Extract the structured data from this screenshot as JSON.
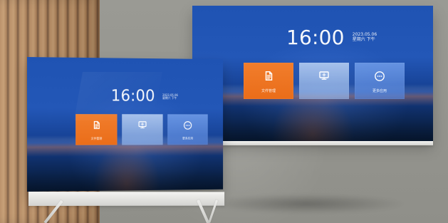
{
  "background": {
    "wall_color": "#9b9b95",
    "wood_color": "#b88b61"
  },
  "displays": {
    "large": {
      "time": "16:00",
      "date_line1": "2023.05.06",
      "date_line2": "星期六 下午",
      "tiles": [
        {
          "label": "文件管理",
          "icon": "document-icon",
          "color": "#ea6d19"
        },
        {
          "label": "",
          "icon": "screen-share-icon",
          "color": "#b7cff1"
        },
        {
          "label": "更多应用",
          "icon": "more-icon",
          "color": "#5a8fe0"
        }
      ]
    },
    "small": {
      "time": "16:00",
      "date_line1": "2023.05.06",
      "date_line2": "星期六 下午",
      "tiles": [
        {
          "label": "文件管理",
          "icon": "document-icon",
          "color": "#ea6d19"
        },
        {
          "label": "",
          "icon": "screen-share-icon",
          "color": "#b7cff1"
        },
        {
          "label": "更多应用",
          "icon": "more-icon",
          "color": "#5a8fe0"
        }
      ]
    }
  }
}
